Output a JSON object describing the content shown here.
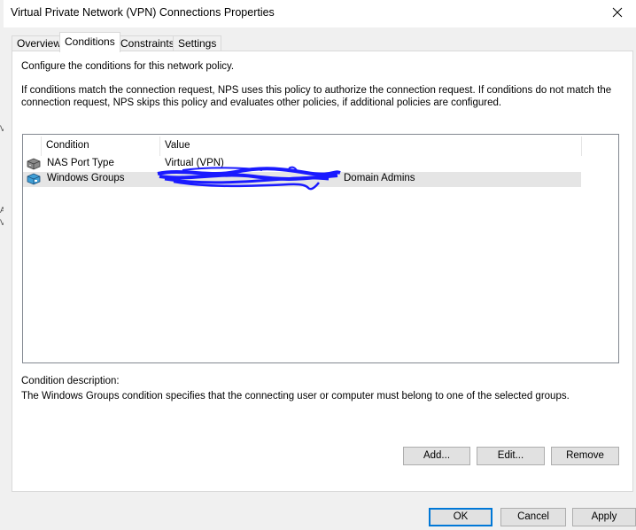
{
  "window": {
    "title": "Virtual Private Network (VPN) Connections Properties"
  },
  "tabs": [
    {
      "label": "Overview"
    },
    {
      "label": "Conditions"
    },
    {
      "label": "Constraints"
    },
    {
      "label": "Settings"
    }
  ],
  "active_tab": "Conditions",
  "panel": {
    "intro": "Configure the conditions for this network policy.",
    "explanation": "If conditions match the connection request, NPS uses this policy to authorize the connection request. If conditions do not match the connection request, NPS skips this policy and evaluates other policies, if additional policies are configured."
  },
  "conditions_list": {
    "columns": [
      "Condition",
      "Value"
    ],
    "rows": [
      {
        "condition": "NAS Port Type",
        "value": "Virtual (VPN)",
        "icon": "nas-port-icon"
      },
      {
        "condition": "Windows Groups",
        "value_visible_suffix": "Domain Admins",
        "icon": "windows-groups-icon",
        "selected": true
      }
    ]
  },
  "description": {
    "label": "Condition description:",
    "text": "The Windows Groups condition specifies that the connecting user or computer must belong to one of the selected groups."
  },
  "buttons": {
    "add": "Add...",
    "edit": "Edit...",
    "remove": "Remove",
    "ok": "OK",
    "cancel": "Cancel",
    "apply": "Apply"
  },
  "colors": {
    "redaction_scribble": "#1a1aff",
    "default_button_border": "#0078d7"
  }
}
